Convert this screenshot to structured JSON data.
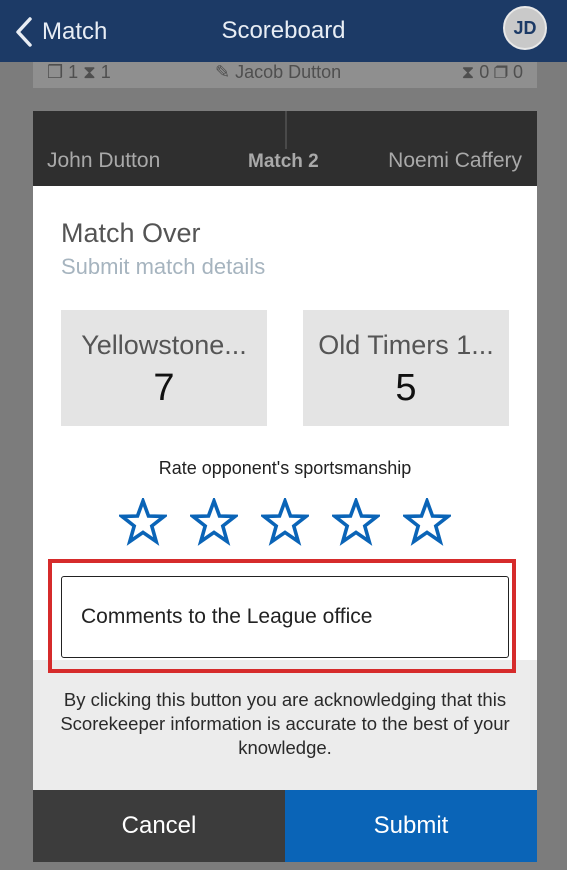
{
  "nav": {
    "back_label": "Match",
    "title": "Scoreboard",
    "avatar_initials": "JD"
  },
  "background": {
    "card1": {
      "left_stats": "❒ 1 ⧗ 1",
      "scorer": "✎ Jacob Dutton",
      "right_stats": "⧗ 0 ❒ 0"
    },
    "card2": {
      "player1": "John Dutton",
      "match_label": "Match 2",
      "player2": "Noemi Caffery"
    }
  },
  "modal": {
    "title": "Match Over",
    "subtitle": "Submit match details",
    "teams": [
      {
        "name": "Yellowstone...",
        "score": "7"
      },
      {
        "name": "Old Timers 1...",
        "score": "5"
      }
    ],
    "rating_label": "Rate opponent's sportsmanship",
    "rating": {
      "value": 0,
      "max": 5,
      "icon": "star-outline-icon"
    },
    "comment_placeholder": "Comments to the League office",
    "acknowledgement": "By clicking this button you are acknowledging that this Scorekeeper information is accurate to the best of your knowledge.",
    "cancel_label": "Cancel",
    "submit_label": "Submit"
  },
  "colors": {
    "nav_bg": "#1c3a66",
    "star": "#0a64b7",
    "highlight": "#d62b2b",
    "submit_bg": "#0a64b7",
    "cancel_bg": "#3c3c3c"
  }
}
